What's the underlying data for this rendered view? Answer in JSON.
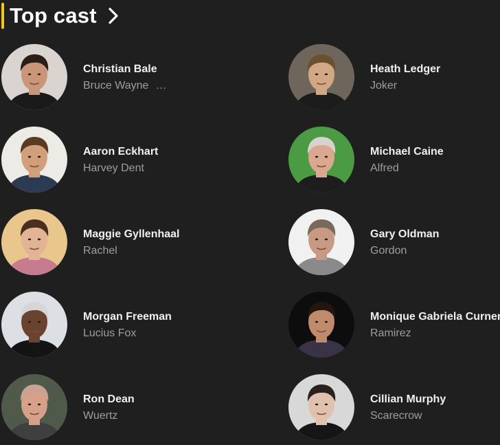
{
  "section": {
    "title": "Top cast",
    "accent_color": "#f5c518",
    "more_icon": "chevron-right-icon"
  },
  "cast": [
    {
      "name": "Christian Bale",
      "role": "Bruce Wayne",
      "role_more": "…",
      "photo": {
        "bg": "#d9d4cf",
        "skin": "#c9967a",
        "hair": "#2b1e17",
        "shirt": "#1a1a1a"
      }
    },
    {
      "name": "Heath Ledger",
      "role": "Joker",
      "photo": {
        "bg": "#6f665b",
        "skin": "#d2a783",
        "hair": "#6b5030",
        "shirt": "#1c1c1c"
      }
    },
    {
      "name": "Aaron Eckhart",
      "role": "Harvey Dent",
      "photo": {
        "bg": "#ecebe5",
        "skin": "#d29f7b",
        "hair": "#5a3b22",
        "shirt": "#2c3a52"
      }
    },
    {
      "name": "Michael Caine",
      "role": "Alfred",
      "photo": {
        "bg": "#4a9b44",
        "skin": "#d9a88e",
        "hair": "#d7d2cc",
        "shirt": "#1d1d1d"
      }
    },
    {
      "name": "Maggie Gyllenhaal",
      "role": "Rachel",
      "photo": {
        "bg": "#e8c68c",
        "skin": "#e2b394",
        "hair": "#4a2f1e",
        "shirt": "#c77b8e"
      }
    },
    {
      "name": "Gary Oldman",
      "role": "Gordon",
      "photo": {
        "bg": "#f1f1f1",
        "skin": "#c89a83",
        "hair": "#7a6a5c",
        "shirt": "#8a8a8a"
      }
    },
    {
      "name": "Morgan Freeman",
      "role": "Lucius Fox",
      "photo": {
        "bg": "#dcdfe3",
        "skin": "#6a4330",
        "hair": "#d6d6d6",
        "shirt": "#141414"
      }
    },
    {
      "name": "Monique Gabriela Curnen",
      "role": "Ramirez",
      "photo": {
        "bg": "#0d0d0d",
        "skin": "#c08a6d",
        "hair": "#24160f",
        "shirt": "#3a3347"
      }
    },
    {
      "name": "Ron Dean",
      "role": "Wuertz",
      "photo": {
        "bg": "#505a4a",
        "skin": "#d7a088",
        "hair": "#c9a292",
        "shirt": "#3f3f3f"
      }
    },
    {
      "name": "Cillian Murphy",
      "role": "Scarecrow",
      "photo": {
        "bg": "#d8d8d8",
        "skin": "#e0c1ad",
        "hair": "#2a211d",
        "shirt": "#151515"
      }
    }
  ]
}
